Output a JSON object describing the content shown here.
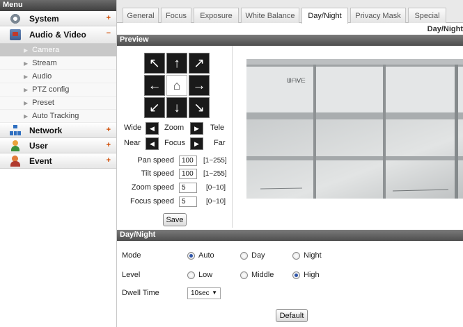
{
  "menu": {
    "header": "Menu",
    "groups": {
      "system": {
        "label": "System",
        "toggle": "+",
        "icon": "gear-icon"
      },
      "audio_video": {
        "label": "Audio & Video",
        "toggle": "−",
        "icon": "camera-icon"
      },
      "network": {
        "label": "Network",
        "toggle": "+",
        "icon": "network-icon"
      },
      "user": {
        "label": "User",
        "toggle": "+",
        "icon": "user-icon"
      },
      "event": {
        "label": "Event",
        "toggle": "+",
        "icon": "event-icon"
      }
    },
    "sub_items": [
      "Camera",
      "Stream",
      "Audio",
      "PTZ config",
      "Preset",
      "Auto Tracking"
    ],
    "sub_arrow": "▶",
    "active_sub": "Camera"
  },
  "tabs": [
    "General",
    "Focus",
    "Exposure",
    "White Balance",
    "Day/Night",
    "Privacy Mask",
    "Special"
  ],
  "active_tab": "Day/Night",
  "page_label": "Day/Night",
  "preview": {
    "title": "Preview",
    "directions": {
      "up_left": "↖",
      "up": "↑",
      "up_right": "↗",
      "left": "←",
      "home": "⌂",
      "right": "→",
      "down_left": "↙",
      "down": "↓",
      "down_right": "↘"
    },
    "zoom": {
      "left_label": "Wide",
      "center_label": "Zoom",
      "right_label": "Tele",
      "dec": "◀",
      "inc": "▶"
    },
    "focus": {
      "left_label": "Near",
      "center_label": "Focus",
      "right_label": "Far",
      "dec": "◀",
      "inc": "▶"
    },
    "speeds": [
      {
        "label": "Pan speed",
        "value": "100",
        "range": "[1~255]"
      },
      {
        "label": "Tilt speed",
        "value": "100",
        "range": "[1~255]"
      },
      {
        "label": "Zoom speed",
        "value": "5",
        "range": "[0~10]"
      },
      {
        "label": "Focus speed",
        "value": "5",
        "range": "[0~10]"
      }
    ],
    "save_label": "Save",
    "video_overlay_text": "ᗯᗩᐯᗴ"
  },
  "daynight": {
    "title": "Day/Night",
    "mode": {
      "label": "Mode",
      "options": [
        "Auto",
        "Day",
        "Night"
      ],
      "selected": "Auto"
    },
    "level": {
      "label": "Level",
      "options": [
        "Low",
        "Middle",
        "High"
      ],
      "selected": "High"
    },
    "dwell": {
      "label": "Dwell Time",
      "value": "10sec",
      "caret": "▼"
    },
    "default_label": "Default"
  },
  "colors": {
    "section_bar": "#5a5a5a",
    "toggle": "#d04a00",
    "radio_checked": "#2d54a8"
  }
}
